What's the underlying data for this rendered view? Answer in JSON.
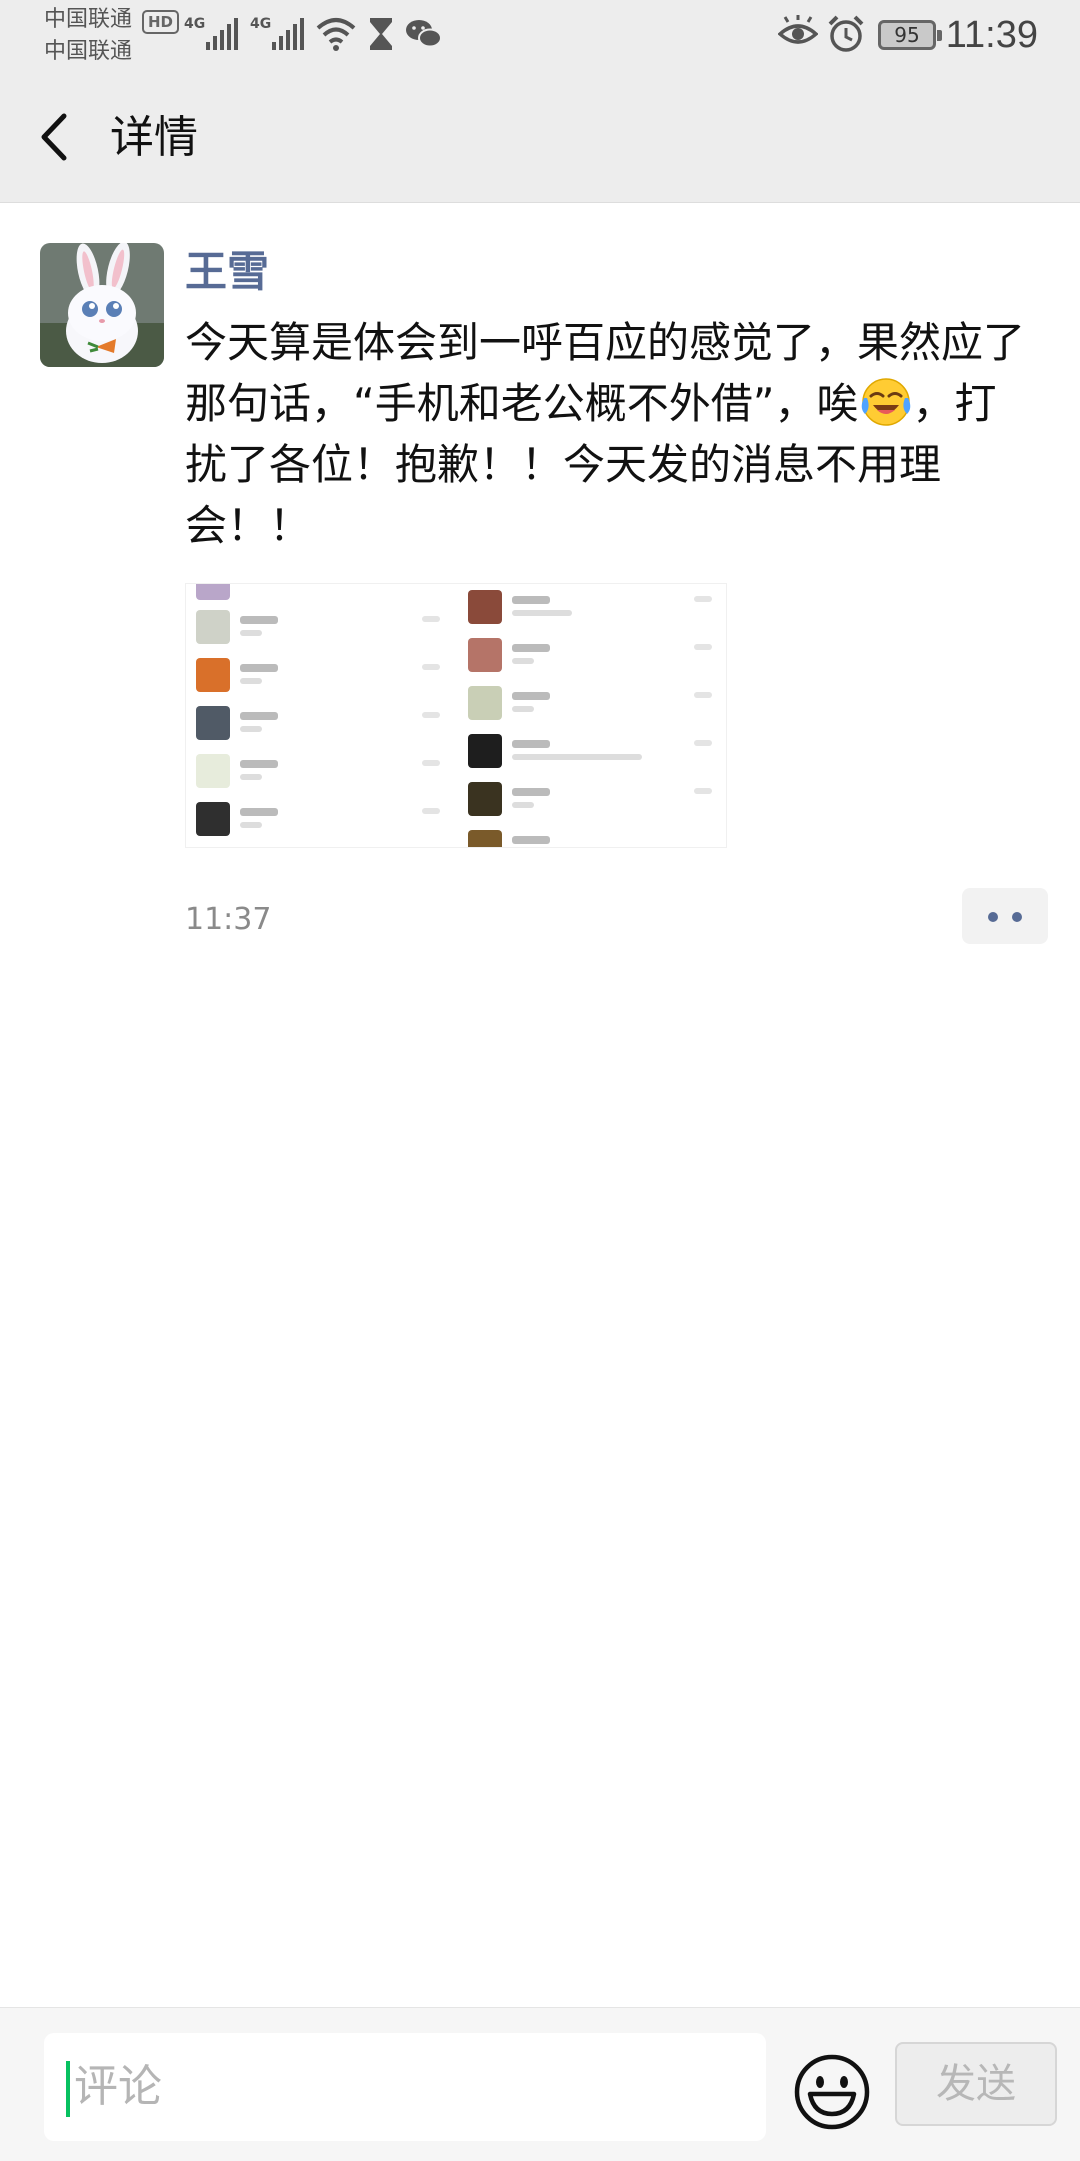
{
  "status_bar": {
    "carrier_1": "中国联通",
    "carrier_2": "中国联通",
    "hd_badge": "HD",
    "network_1": "4G",
    "network_2": "4G",
    "battery_level": "95",
    "time": "11:39",
    "icons": [
      "signal-icon",
      "signal-icon",
      "wifi-icon",
      "hourglass-icon",
      "wechat-icon",
      "eye-icon",
      "alarm-icon",
      "battery-icon"
    ]
  },
  "header": {
    "title": "详情",
    "back_icon": "chevron-left-icon"
  },
  "post": {
    "author": "王雪",
    "text_part1": "今天算是体会到一呼百应的感觉了，果然应了那句话，“手机和老公概不外借”，唉",
    "text_part2": "，打扰了各位！抱歉！！今天发的消息不用理会！！",
    "emoji": "crying-laughing-emoji",
    "image": "chat-list-screenshot",
    "time": "11:37",
    "more_icon": "two-dots-icon"
  },
  "comment_bar": {
    "placeholder": "评论",
    "emoji_icon": "smiley-icon",
    "send_label": "发送"
  },
  "colors": {
    "name_blue": "#576b95",
    "bar_gray": "#ededed",
    "caret_green": "#07c160"
  }
}
